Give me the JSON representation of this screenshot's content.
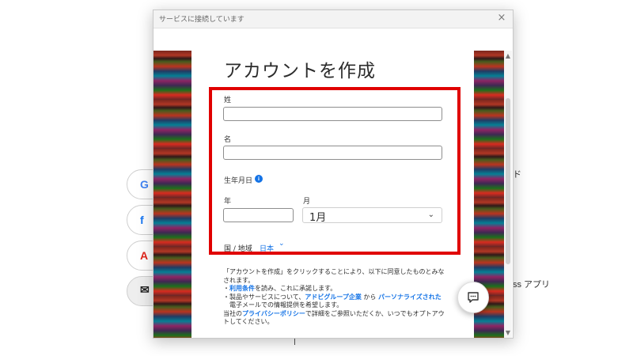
{
  "dialog": {
    "title": "サービスに接続しています",
    "close_glyph": "×"
  },
  "form": {
    "heading": "アカウントを作成",
    "last_name_label": "姓",
    "last_name_value": "",
    "first_name_label": "名",
    "first_name_value": "",
    "birthdate_label": "生年月日",
    "info_glyph": "i",
    "year_label": "年",
    "year_value": "",
    "month_label": "月",
    "month_value": "1月",
    "chevron": "⌄",
    "country_label": "国 / 地域",
    "country_value": "日本"
  },
  "terms": {
    "intro": "「アカウントを作成」をクリックすることにより、以下に同意したものとみなされます。",
    "bullet1_link": "利用条件",
    "bullet1_rest": "を読み、これに承諾します。",
    "bullet2_pre": "製品やサービスについて、",
    "bullet2_link1": "アドビグループ企業",
    "bullet2_mid": " から ",
    "bullet2_link2": "パーソナライズされた",
    "bullet2_rest": " 電子メールでの情報提供を希望します。",
    "footer_pre": "当社の",
    "footer_link": "プライバシーポリシー",
    "footer_rest": "で詳細をご参照いただくか、いつでもオプトアウトしてください。"
  },
  "background": {
    "social_icons": [
      "G",
      "f",
      "A",
      "✉"
    ],
    "right_text_1": "ド",
    "right_text_2": "ss アプリ"
  },
  "icons": {
    "chat": "chat-icon"
  },
  "colors": {
    "accent": "#1473e6",
    "highlight_border": "#e00000"
  }
}
